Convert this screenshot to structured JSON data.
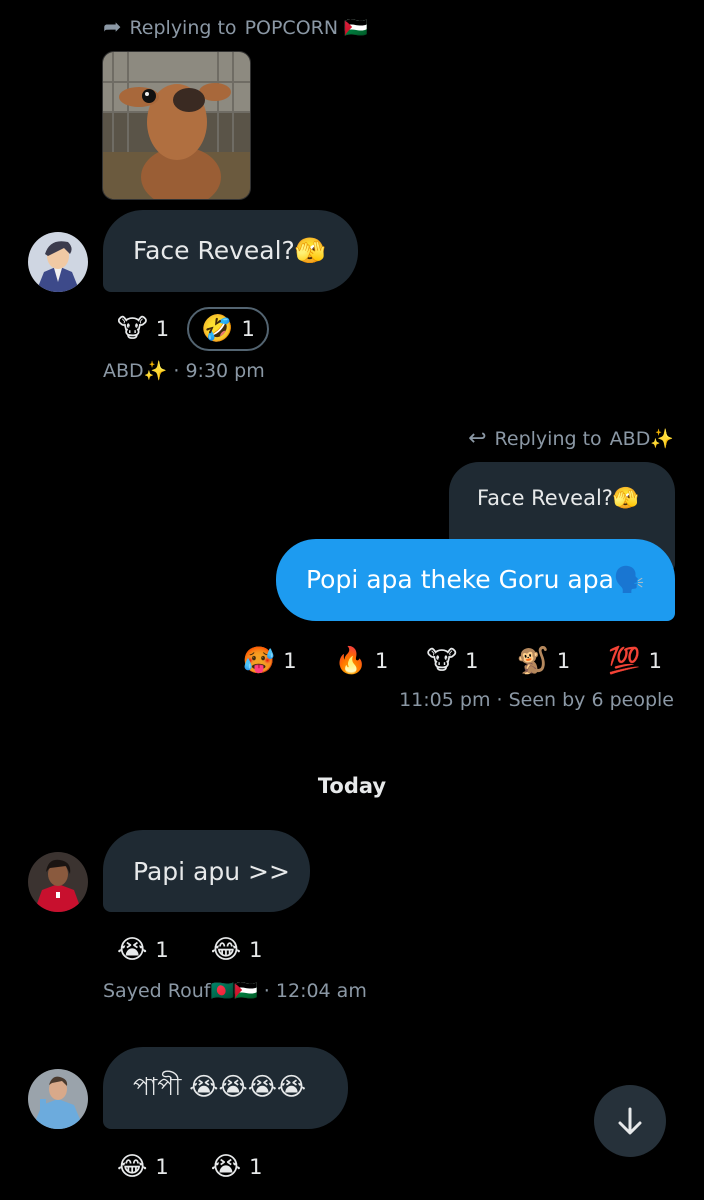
{
  "messages": {
    "m1": {
      "reply_prefix": "Replying to",
      "reply_target": "POPCORN 🇵🇸",
      "text": "Face Reveal?🫣",
      "reactions": [
        {
          "emoji": "🐮",
          "count": "1"
        },
        {
          "emoji": "🤣",
          "count": "1"
        }
      ],
      "sender": "ABD✨",
      "time": "9:30 pm"
    },
    "m2": {
      "reply_prefix": "Replying to",
      "reply_target": "ABD✨",
      "quoted_text": "Face Reveal?🫣",
      "text": "Popi apa theke Goru apa🗣️",
      "reactions": [
        {
          "emoji": "🥵",
          "count": "1"
        },
        {
          "emoji": "🔥",
          "count": "1"
        },
        {
          "emoji": "🐮",
          "count": "1"
        },
        {
          "emoji": "🐒",
          "count": "1"
        },
        {
          "emoji": "💯",
          "count": "1"
        }
      ],
      "time": "11:05 pm",
      "seen": "Seen by 6 people"
    },
    "day_separator": "Today",
    "m3": {
      "text": "Papi apu >>",
      "reactions": [
        {
          "emoji": "😭",
          "count": "1"
        },
        {
          "emoji": "😂",
          "count": "1"
        }
      ],
      "sender": "Sayed Rouf🇧🇩🇵🇸",
      "time": "12:04 am"
    },
    "m4": {
      "text": "পাপী 😭😭😭😭",
      "reactions": [
        {
          "emoji": "😂",
          "count": "1"
        },
        {
          "emoji": "😭",
          "count": "1"
        }
      ]
    }
  },
  "icons": {
    "reply_forward": "share-arrow-icon",
    "reply_back": "reply-arrow-icon",
    "scroll_down": "arrow-down-icon"
  },
  "colors": {
    "background": "#000000",
    "incoming_bubble": "#1f2a33",
    "outgoing_bubble": "#1d9bf0",
    "secondary_text": "#8b98a5"
  },
  "separator": " · "
}
